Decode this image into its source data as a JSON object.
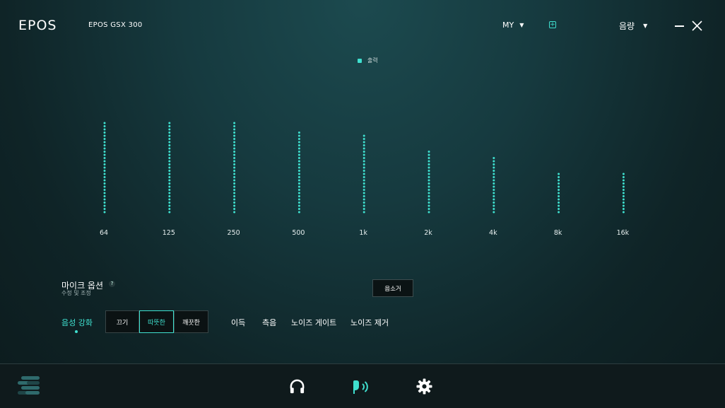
{
  "header": {
    "logo": "EPOS",
    "device": "EPOS GSX 300",
    "profile": "MY",
    "volume": "음량"
  },
  "legend": {
    "label": "출력",
    "color": "#3fe0cf"
  },
  "equalizer": {
    "bands": [
      {
        "label": "64",
        "level": 0.98
      },
      {
        "label": "125",
        "level": 0.98
      },
      {
        "label": "250",
        "level": 0.97
      },
      {
        "label": "500",
        "level": 0.86
      },
      {
        "label": "1k",
        "level": 0.83
      },
      {
        "label": "2k",
        "level": 0.65
      },
      {
        "label": "4k",
        "level": 0.6
      },
      {
        "label": "8k",
        "level": 0.42
      },
      {
        "label": "16k",
        "level": 0.42
      }
    ]
  },
  "mic_options": {
    "title": "마이크 옵션",
    "help": "?",
    "subtitle": "수정 및 조정",
    "reset": "음소거"
  },
  "tabs": {
    "voice": "음성 강화",
    "presets": [
      "끄기",
      "따뜻한",
      "깨끗한"
    ],
    "active_preset": "따뜻한",
    "items": [
      "이득",
      "측음",
      "노이즈 게이트",
      "노이즈 제거"
    ]
  },
  "colors": {
    "accent": "#3fe0cf",
    "background": "#163a3f",
    "footer": "#0f1a1c"
  },
  "footer": {
    "icons": [
      "menu-icon",
      "headphones-icon",
      "microphone-icon",
      "settings-icon"
    ],
    "active": "microphone-icon"
  }
}
